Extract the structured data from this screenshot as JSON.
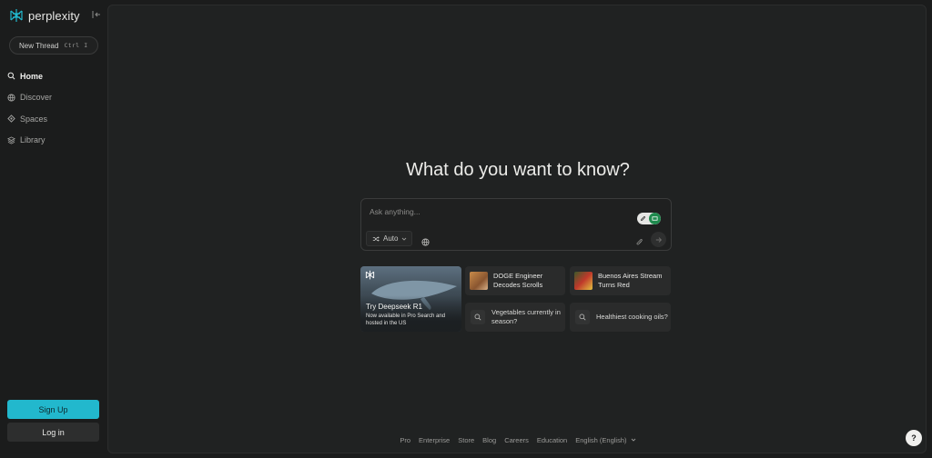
{
  "app": {
    "logo_text": "perplexity"
  },
  "sidebar": {
    "new_thread": {
      "label": "New Thread",
      "shortcut_mod": "Ctrl",
      "shortcut_key": "I"
    },
    "items": [
      {
        "label": "Home",
        "icon": "search-icon",
        "active": true
      },
      {
        "label": "Discover",
        "icon": "globe-icon",
        "active": false
      },
      {
        "label": "Spaces",
        "icon": "spaces-icon",
        "active": false
      },
      {
        "label": "Library",
        "icon": "library-icon",
        "active": false
      }
    ],
    "signup_label": "Sign Up",
    "login_label": "Log in"
  },
  "main": {
    "headline": "What do you want to know?",
    "search": {
      "placeholder": "Ask anything...",
      "mode_label": "Auto"
    },
    "feature_card": {
      "title": "Try Deepseek R1",
      "subtitle": "Now available in Pro Search and hosted in the US"
    },
    "news": [
      {
        "title": "DOGE Engineer Decodes Scrolls"
      },
      {
        "title": "Buenos Aires Stream Turns Red"
      }
    ],
    "questions": [
      {
        "text": "Vegetables currently in season?"
      },
      {
        "text": "Healthiest cooking oils?"
      }
    ]
  },
  "footer": {
    "links": [
      "Pro",
      "Enterprise",
      "Store",
      "Blog",
      "Careers",
      "Education"
    ],
    "language": "English (English)"
  },
  "help_label": "?",
  "colors": {
    "accent": "#22b8cd",
    "toggle_on": "#1f8a4e",
    "background": "#1b1c1c",
    "panel": "#202222"
  }
}
